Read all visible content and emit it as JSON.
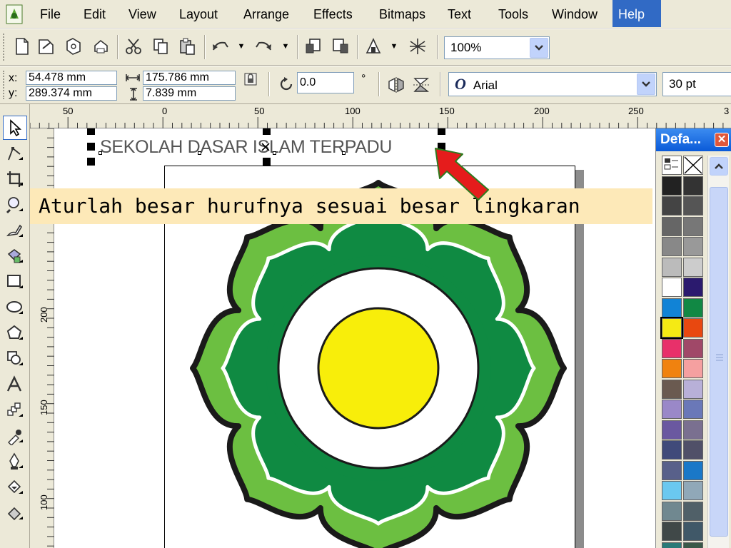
{
  "menu": {
    "items": [
      "File",
      "Edit",
      "View",
      "Layout",
      "Arrange",
      "Effects",
      "Bitmaps",
      "Text",
      "Tools",
      "Window",
      "Help"
    ],
    "active": "Help"
  },
  "toolbar": {
    "zoom_value": "100%"
  },
  "property_bar": {
    "x_label": "x:",
    "x_value": "54.478 mm",
    "y_label": "y:",
    "y_value": "289.374 mm",
    "width_value": "175.786 mm",
    "height_value": "7.839 mm",
    "rotation_value": "0.0",
    "degree_symbol": "°",
    "font_name": "Arial",
    "font_size": "30 pt"
  },
  "ruler": {
    "top_labels": [
      "50",
      "0",
      "50",
      "100",
      "150",
      "200",
      "250",
      "3"
    ],
    "left_labels": [
      "250",
      "200",
      "150",
      "100"
    ]
  },
  "canvas": {
    "selected_text": "SEKOLAH DASAR ISLAM TERPADU"
  },
  "instruction": "Aturlah besar hurufnya sesuai besar lingkaran",
  "palette": {
    "title": "Defa...",
    "close_glyph": "✕",
    "swatches": [
      "#ffffff",
      "#ffffff",
      "#222222",
      "#333333",
      "#444444",
      "#555555",
      "#666666",
      "#777777",
      "#888888",
      "#999999",
      "#bbbbbb",
      "#cccccc",
      "#ffffff",
      "#2b1a6e",
      "#1183d6",
      "#118844",
      "#f5ea14",
      "#e84810",
      "#e8306a",
      "#a04868",
      "#f0820f",
      "#f5a0a0",
      "#6a5a50",
      "#b8b0d8",
      "#9a88c8",
      "#6a78b8",
      "#6a58a0",
      "#7a7090",
      "#404a7a",
      "#505068",
      "#58608a",
      "#1a78c8",
      "#6ac8f0",
      "#90a8b8",
      "#708890",
      "#506068",
      "#404848",
      "#405868",
      "#2a7a78",
      "#3a5848"
    ]
  },
  "colors": {
    "logo_outer_fill": "#6cbf41",
    "logo_dark_green": "#0f8a42",
    "logo_center_yellow": "#f8ee0a",
    "arrow_red": "#e51c1c"
  }
}
